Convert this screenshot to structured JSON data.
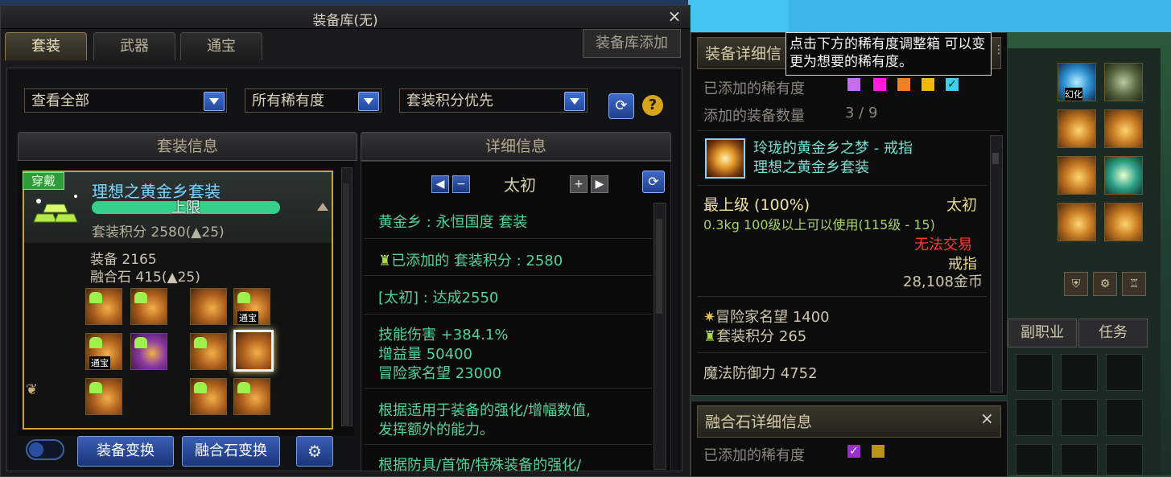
{
  "main_window": {
    "title": "装备库(无)",
    "close_glyph": "×",
    "tabs": [
      "套装",
      "武器",
      "通宝"
    ],
    "add_button": "装备库添加"
  },
  "filters": {
    "view": "查看全部",
    "rarity": "所有稀有度",
    "sort": "套装积分优先"
  },
  "set_info": {
    "header": "套装信息",
    "wearing_badge": "穿戴",
    "set_name": "理想之黄金乡套装",
    "bar_label": "上限",
    "score_line": "套装积分 2580(▲25)",
    "equip_line": "装备   2165",
    "fusion_line": "融合石 415(▲25)",
    "slot_tag": "通宝",
    "buttons": {
      "equip_swap": "装备变换",
      "fusion_swap": "融合石变换"
    }
  },
  "detail_info": {
    "header": "详细信息",
    "grade": "太初",
    "set_title": "黄金乡 : 永恒国度   套装",
    "added_score": "已添加的 套装积分 : 2580",
    "achieved": "[太初] : 达成2550",
    "stats": [
      "技能伤害 +384.1%",
      "增益量 50400",
      "冒险家名望 23000"
    ],
    "desc1": "根据适用于装备的强化/增幅数值,",
    "desc2": "发挥额外的能力。",
    "desc3": "根据防具/首饰/特殊装备的强化/"
  },
  "right_panel": {
    "header": "装备详细信",
    "tooltip": "点击下方的稀有度调整箱 可以变更为想要的稀有度。",
    "added_rarity_label": "已添加的稀有度",
    "added_count_label": "添加的装备数量",
    "added_count": "3 / 9",
    "rarity_colors": [
      "#c86bf0",
      "#ff1ae0",
      "#f08020",
      "#f3b800",
      "#3ad0f0"
    ],
    "item": {
      "name": "玲珑的黄金乡之梦 - 戒指",
      "set": "理想之黄金乡套装",
      "grade_line": "最上级 (100%)",
      "grade": "太初",
      "weight_line": "0.3kg   100级以上可以使用(115级 - 15)",
      "trade": "无法交易",
      "slot": "戒指",
      "price": "28,108金币",
      "fame": "冒险家名望 1400",
      "set_score": "套装积分 265",
      "magic_def": "魔法防御力 4752"
    },
    "fusion_header": "融合石详细信息",
    "fusion_rarity_label": "已添加的稀有度",
    "fusion_colors": [
      "#9a2fd0",
      "#b89318"
    ]
  },
  "inventory": {
    "tabs": [
      "副职业",
      "任务"
    ],
    "icon_label": "幻化"
  }
}
